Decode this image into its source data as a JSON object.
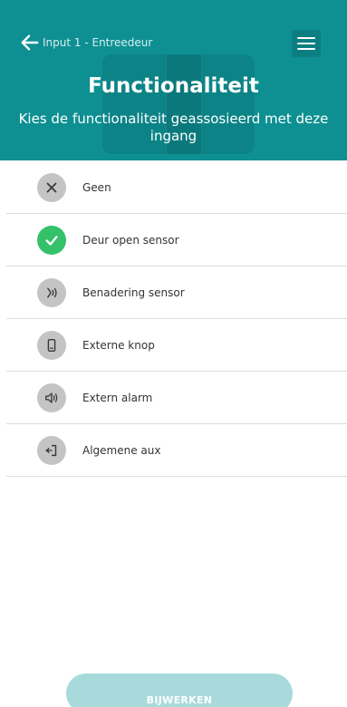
{
  "header": {
    "back_label": "Input 1 - Entreedeur",
    "title": "Functionaliteit",
    "subtitle": "Kies de functionaliteit geassosieerd met deze ingang",
    "background_color": "#0e9093"
  },
  "options": [
    {
      "label": "Geen",
      "icon": "x-icon",
      "selected": false
    },
    {
      "label": "Deur open sensor",
      "icon": "checkmark-icon",
      "selected": true
    },
    {
      "label": "Benadering sensor",
      "icon": "proximity-sensor-icon",
      "selected": false
    },
    {
      "label": "Externe knop",
      "icon": "external-button-icon",
      "selected": false
    },
    {
      "label": "Extern alarm",
      "icon": "speaker-icon",
      "selected": false
    },
    {
      "label": "Algemene aux",
      "icon": "aux-input-icon",
      "selected": false
    }
  ],
  "footer": {
    "update_label": "BIJWERKEN",
    "button_color": "#a8dadb"
  },
  "colors": {
    "selected": "#35c16a",
    "unselected": "#c4c4c4"
  }
}
